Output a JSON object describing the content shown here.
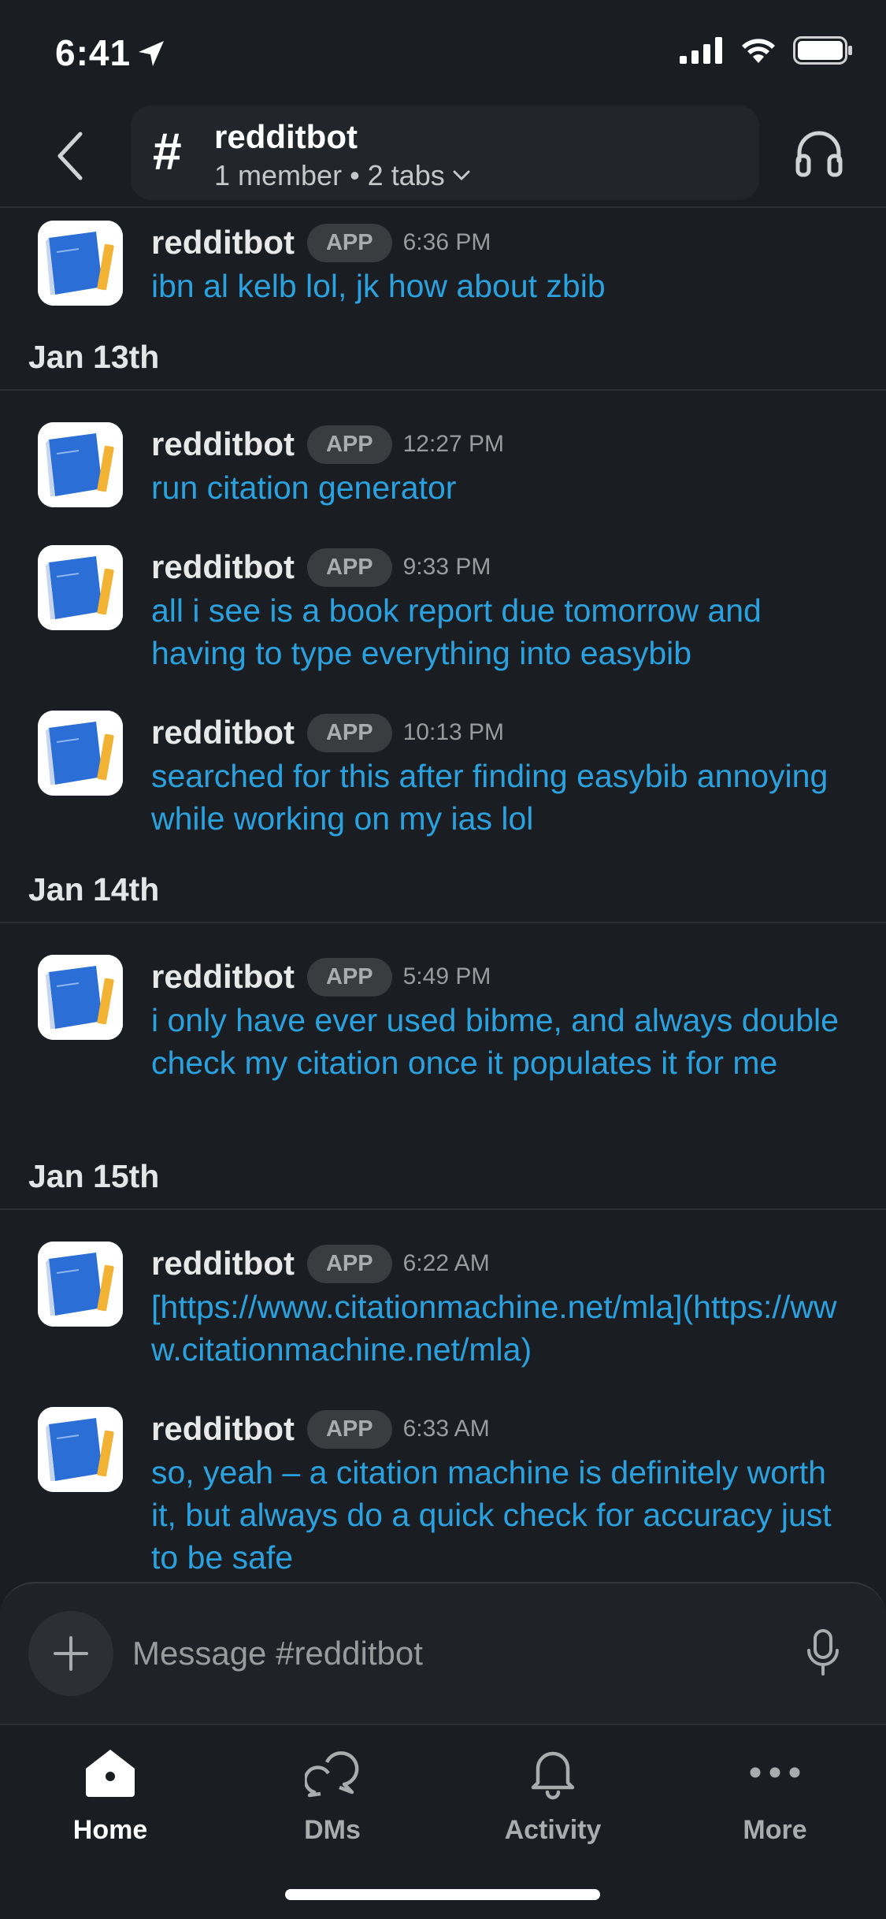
{
  "status_bar": {
    "time": "6:41"
  },
  "header": {
    "channel_hash": "#",
    "channel_name": "redditbot",
    "members": "1 member",
    "separator": "•",
    "tabs": "2 tabs"
  },
  "messages": [
    {
      "sender": "redditbot",
      "badge": "APP",
      "time": "6:36 PM",
      "text": "ibn al kelb lol, jk how about zbib"
    },
    {
      "sender": "redditbot",
      "badge": "APP",
      "time": "12:27 PM",
      "text": "run citation generator"
    },
    {
      "sender": "redditbot",
      "badge": "APP",
      "time": "9:33 PM",
      "text": "all i see is a book report due tomorrow and having to type everything into easybib"
    },
    {
      "sender": "redditbot",
      "badge": "APP",
      "time": "10:13 PM",
      "text": "searched for this after finding easybib annoying while working on my ias lol"
    },
    {
      "sender": "redditbot",
      "badge": "APP",
      "time": "5:49 PM",
      "text": "i only have ever used bibme, and always double check my citation once it populates it for me"
    },
    {
      "sender": "redditbot",
      "badge": "APP",
      "time": "6:22 AM",
      "text": "[https://www.citationmachine.net/mla](https://www.citationmachine.net/mla)"
    },
    {
      "sender": "redditbot",
      "badge": "APP",
      "time": "6:33 AM",
      "text": "so, yeah – a citation machine is definitely worth it, but always do a quick check for accuracy just to be safe"
    }
  ],
  "date_separators": [
    "Jan 13th",
    "Jan 14th",
    "Jan 15th"
  ],
  "composer": {
    "placeholder": "Message #redditbot"
  },
  "tabbar": {
    "home": "Home",
    "dms": "DMs",
    "activity": "Activity",
    "more": "More"
  },
  "colors": {
    "background": "#1a1d21",
    "message_text": "#2aa2e0",
    "badge_bg": "#3a3c40"
  }
}
